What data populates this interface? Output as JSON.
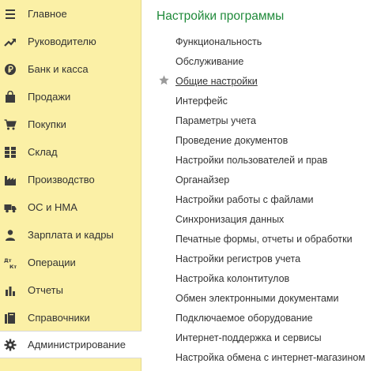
{
  "sidebar": {
    "items": [
      {
        "label": "Главное",
        "icon": "menu-lines-icon"
      },
      {
        "label": "Руководителю",
        "icon": "trend-up-icon"
      },
      {
        "label": "Банк и касса",
        "icon": "ruble-coin-icon"
      },
      {
        "label": "Продажи",
        "icon": "shopping-bag-icon"
      },
      {
        "label": "Покупки",
        "icon": "shopping-cart-icon"
      },
      {
        "label": "Склад",
        "icon": "warehouse-grid-icon"
      },
      {
        "label": "Производство",
        "icon": "factory-icon"
      },
      {
        "label": "ОС и НМА",
        "icon": "truck-icon"
      },
      {
        "label": "Зарплата и кадры",
        "icon": "person-icon"
      },
      {
        "label": "Операции",
        "icon": "dt-kt-icon"
      },
      {
        "label": "Отчеты",
        "icon": "bar-chart-icon"
      },
      {
        "label": "Справочники",
        "icon": "books-icon"
      },
      {
        "label": "Администрирование",
        "icon": "gear-icon"
      }
    ],
    "active_index": 12
  },
  "main": {
    "title": "Настройки программы",
    "links": [
      {
        "label": "Функциональность"
      },
      {
        "label": "Обслуживание"
      },
      {
        "label": "Общие настройки",
        "favorite": true
      },
      {
        "label": "Интерфейс"
      },
      {
        "label": "Параметры учета"
      },
      {
        "label": "Проведение документов"
      },
      {
        "label": "Настройки пользователей и прав"
      },
      {
        "label": "Органайзер"
      },
      {
        "label": "Настройки работы с файлами"
      },
      {
        "label": "Синхронизация данных"
      },
      {
        "label": "Печатные формы, отчеты и обработки"
      },
      {
        "label": "Настройки регистров учета"
      },
      {
        "label": "Настройка колонтитулов"
      },
      {
        "label": "Обмен электронными документами"
      },
      {
        "label": "Подключаемое оборудование"
      },
      {
        "label": "Интернет-поддержка и сервисы"
      },
      {
        "label": "Настройка обмена с интернет-магазином"
      }
    ]
  },
  "colors": {
    "sidebar_bg": "#fbf0a6",
    "title_green": "#1f8a3a",
    "icon_dark": "#3c3c3c",
    "star_gray": "#9a9a9a"
  }
}
